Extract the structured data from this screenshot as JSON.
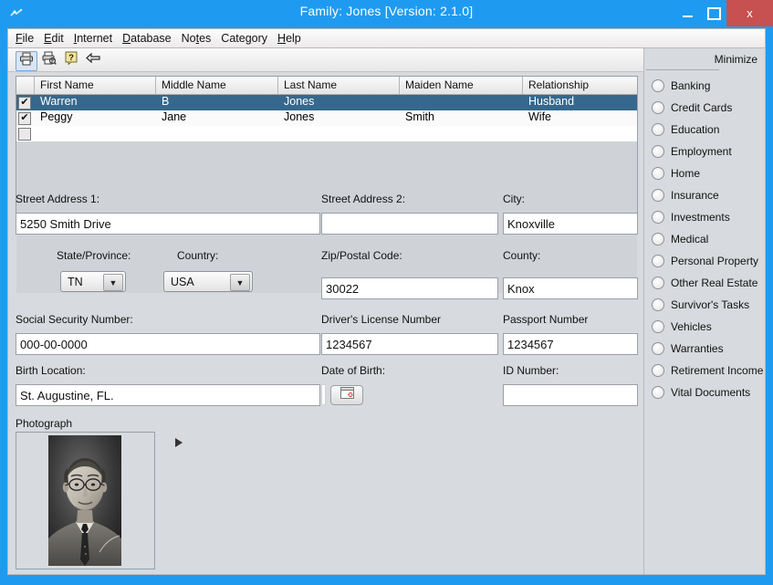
{
  "window": {
    "title": "Family: Jones [Version: 2.1.0]",
    "app_icon": "app-icon",
    "minimize_label": "–",
    "maximize_label": "",
    "close_label": "x",
    "accent_color": "#1e9bf0",
    "close_color": "#c75050"
  },
  "menu": {
    "items": [
      {
        "pre": "",
        "key": "F",
        "post": "ile"
      },
      {
        "pre": "",
        "key": "E",
        "post": "dit"
      },
      {
        "pre": "",
        "key": "I",
        "post": "nternet"
      },
      {
        "pre": "",
        "key": "D",
        "post": "atabase"
      },
      {
        "pre": "No",
        "key": "t",
        "post": "es"
      },
      {
        "pre": "Cate",
        "key": "g",
        "post": "ory"
      },
      {
        "pre": "",
        "key": "H",
        "post": "elp"
      }
    ]
  },
  "toolbar": {
    "buttons": [
      {
        "name": "print-icon",
        "title": "Print"
      },
      {
        "name": "print-preview-icon",
        "title": "Print Preview"
      },
      {
        "name": "help-icon",
        "title": "Help"
      },
      {
        "name": "back-arrow-icon",
        "title": "Back"
      }
    ]
  },
  "grid": {
    "columns": [
      "",
      "First Name",
      "Middle Name",
      "Last Name",
      "Maiden Name",
      "Relationship"
    ],
    "rows": [
      {
        "checked": true,
        "selected": true,
        "first": "Warren",
        "middle": "B",
        "last": "Jones",
        "maiden": "",
        "relationship": "Husband"
      },
      {
        "checked": true,
        "selected": false,
        "first": "Peggy",
        "middle": "Jane",
        "last": "Jones",
        "maiden": "Smith",
        "relationship": "Wife"
      },
      {
        "checked": false,
        "selected": false,
        "first": "",
        "middle": "",
        "last": "",
        "maiden": "",
        "relationship": ""
      }
    ],
    "checkmark": "✔"
  },
  "form": {
    "street1": {
      "label": "Street Address 1:",
      "value": "5250 Smith Drive"
    },
    "street2": {
      "label": "Street Address 2:",
      "value": ""
    },
    "city": {
      "label": "City:",
      "value": "Knoxville"
    },
    "state": {
      "label": "State/Province:",
      "value": "TN"
    },
    "country": {
      "label": "Country:",
      "value": "USA"
    },
    "zip": {
      "label": "Zip/Postal Code:",
      "value": "30022"
    },
    "county": {
      "label": "County:",
      "value": "Knox"
    },
    "ssn": {
      "label": "Social Security Number:",
      "value": "000-00-0000"
    },
    "dl": {
      "label": "Driver's License Number",
      "value": "1234567"
    },
    "passport": {
      "label": "Passport Number",
      "value": "1234567"
    },
    "birth_location": {
      "label": "Birth Location:",
      "value": "St. Augustine, FL."
    },
    "dob": {
      "label": "Date of Birth:",
      "value": "",
      "button_icon": "calendar-icon"
    },
    "id_number": {
      "label": "ID Number:",
      "value": ""
    },
    "photograph": {
      "label": "Photograph"
    },
    "dropdown_arrow": "▼"
  },
  "sidebar": {
    "minimize_label": "Minimize",
    "items": [
      {
        "label": "Banking",
        "selected": false
      },
      {
        "label": "Credit Cards",
        "selected": false
      },
      {
        "label": "Education",
        "selected": false
      },
      {
        "label": "Employment",
        "selected": false
      },
      {
        "label": "Home",
        "selected": false
      },
      {
        "label": "Insurance",
        "selected": false
      },
      {
        "label": "Investments",
        "selected": false
      },
      {
        "label": "Medical",
        "selected": false
      },
      {
        "label": "Personal Property",
        "selected": false
      },
      {
        "label": "Other Real Estate",
        "selected": false
      },
      {
        "label": "Survivor's Tasks",
        "selected": false
      },
      {
        "label": "Vehicles",
        "selected": false
      },
      {
        "label": "Warranties",
        "selected": false
      },
      {
        "label": "Retirement Income",
        "selected": false
      },
      {
        "label": "Vital Documents",
        "selected": false
      }
    ]
  }
}
